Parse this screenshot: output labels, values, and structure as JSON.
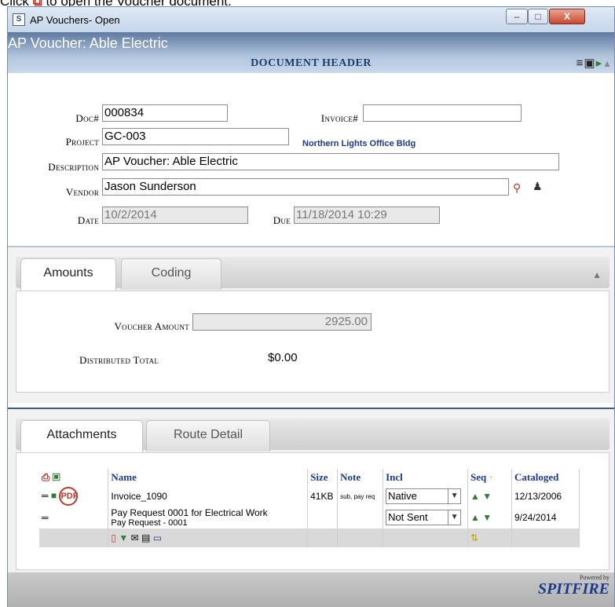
{
  "instruction": {
    "prefix": "Click",
    "icon": "pdf-icon",
    "suffix": "to open the Voucher document."
  },
  "window": {
    "title": "AP Vouchers- Open",
    "min": "–",
    "max": "□",
    "close": "X"
  },
  "doc": {
    "title": "AP Voucher: Able Electric",
    "section_header": "DOCUMENT HEADER"
  },
  "header": {
    "doc_label": "Doc#",
    "doc_value": "000834",
    "invoice_label": "Invoice#",
    "invoice_value": "",
    "project_label": "Project",
    "project_value": "GC-003",
    "project_name": "Northern Lights Office Bldg",
    "description_label": "Description",
    "description_value": "AP Voucher: Able Electric",
    "vendor_label": "Vendor",
    "vendor_value": "Jason Sunderson",
    "date_label": "Date",
    "date_value": "10/2/2014",
    "due_label": "Due",
    "due_value": "11/18/2014 10:29"
  },
  "amounts_panel": {
    "tabs": [
      "Amounts",
      "Coding"
    ],
    "voucher_amount_label": "Voucher Amount",
    "voucher_amount_value": "2925.00",
    "distributed_total_label": "Distributed Total",
    "distributed_total_value": "$0.00"
  },
  "attachments_panel": {
    "tabs": [
      "Attachments",
      "Route Detail"
    ],
    "columns": {
      "name": "Name",
      "size": "Size",
      "note": "Note",
      "incl": "Incl",
      "seq": "Seq",
      "cataloged": "Cataloged"
    },
    "rows": [
      {
        "name": "Invoice_1090",
        "size": "41KB",
        "note": "sub, pay req",
        "incl": "Native",
        "cataloged": "12/13/2006"
      },
      {
        "name": "Pay Request 0001 for Electrical Work",
        "sub": "Pay Request - 0001",
        "size": "",
        "note": "",
        "incl": "Not Sent",
        "cataloged": "9/24/2014"
      }
    ]
  },
  "footer": {
    "powered": "Powered by",
    "brand": "SPITFIRE"
  }
}
